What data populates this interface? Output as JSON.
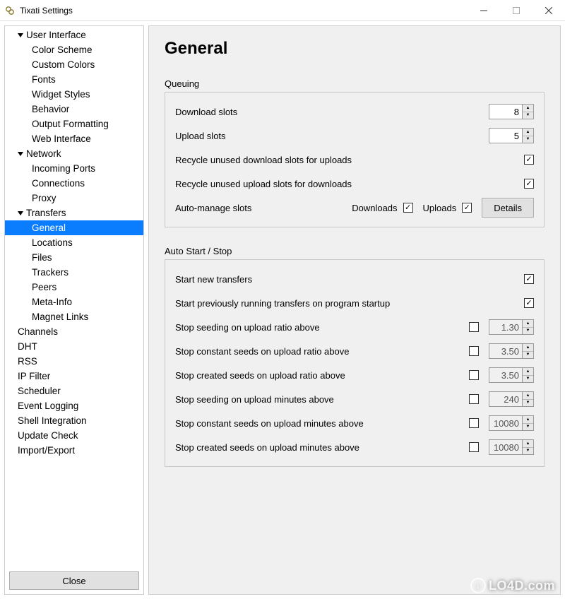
{
  "window": {
    "title": "Tixati Settings"
  },
  "sidebar": {
    "close_label": "Close",
    "items": [
      {
        "label": "User Interface",
        "depth": 1,
        "expanded": true
      },
      {
        "label": "Color Scheme",
        "depth": 2
      },
      {
        "label": "Custom Colors",
        "depth": 2
      },
      {
        "label": "Fonts",
        "depth": 2
      },
      {
        "label": "Widget Styles",
        "depth": 2
      },
      {
        "label": "Behavior",
        "depth": 2
      },
      {
        "label": "Output Formatting",
        "depth": 2
      },
      {
        "label": "Web Interface",
        "depth": 2
      },
      {
        "label": "Network",
        "depth": 1,
        "expanded": true
      },
      {
        "label": "Incoming Ports",
        "depth": 2
      },
      {
        "label": "Connections",
        "depth": 2
      },
      {
        "label": "Proxy",
        "depth": 2
      },
      {
        "label": "Transfers",
        "depth": 1,
        "expanded": true
      },
      {
        "label": "General",
        "depth": 2,
        "selected": true
      },
      {
        "label": "Locations",
        "depth": 2
      },
      {
        "label": "Files",
        "depth": 2
      },
      {
        "label": "Trackers",
        "depth": 2
      },
      {
        "label": "Peers",
        "depth": 2
      },
      {
        "label": "Meta-Info",
        "depth": 2
      },
      {
        "label": "Magnet Links",
        "depth": 2
      },
      {
        "label": "Channels",
        "depth": 1
      },
      {
        "label": "DHT",
        "depth": 1
      },
      {
        "label": "RSS",
        "depth": 1
      },
      {
        "label": "IP Filter",
        "depth": 1
      },
      {
        "label": "Scheduler",
        "depth": 1
      },
      {
        "label": "Event Logging",
        "depth": 1
      },
      {
        "label": "Shell Integration",
        "depth": 1
      },
      {
        "label": "Update Check",
        "depth": 1
      },
      {
        "label": "Import/Export",
        "depth": 1
      }
    ]
  },
  "main": {
    "heading": "General",
    "queuing": {
      "title": "Queuing",
      "download_slots_label": "Download slots",
      "download_slots_value": "8",
      "upload_slots_label": "Upload slots",
      "upload_slots_value": "5",
      "recycle_dl_label": "Recycle unused download slots for uploads",
      "recycle_dl_checked": true,
      "recycle_ul_label": "Recycle unused upload slots for downloads",
      "recycle_ul_checked": true,
      "automanage_label": "Auto-manage slots",
      "downloads_label": "Downloads",
      "downloads_checked": true,
      "uploads_label": "Uploads",
      "uploads_checked": true,
      "details_label": "Details"
    },
    "autostart": {
      "title": "Auto Start / Stop",
      "start_new_label": "Start new transfers",
      "start_new_checked": true,
      "start_prev_label": "Start previously running transfers on program startup",
      "start_prev_checked": true,
      "stop_rows": [
        {
          "label": "Stop seeding on upload ratio above",
          "checked": false,
          "value": "1.30"
        },
        {
          "label": "Stop constant seeds on upload ratio above",
          "checked": false,
          "value": "3.50"
        },
        {
          "label": "Stop created seeds on upload ratio above",
          "checked": false,
          "value": "3.50"
        },
        {
          "label": "Stop seeding on upload minutes above",
          "checked": false,
          "value": "240"
        },
        {
          "label": "Stop constant seeds on upload minutes above",
          "checked": false,
          "value": "10080"
        },
        {
          "label": "Stop created seeds on upload minutes above",
          "checked": false,
          "value": "10080"
        }
      ]
    }
  },
  "watermark": "LO4D.com"
}
